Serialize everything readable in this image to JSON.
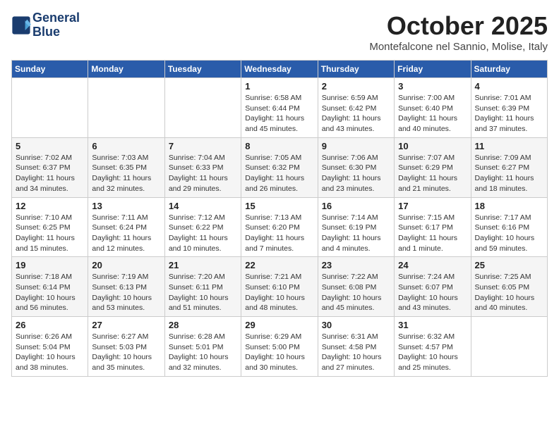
{
  "header": {
    "logo_line1": "General",
    "logo_line2": "Blue",
    "month": "October 2025",
    "location": "Montefalcone nel Sannio, Molise, Italy"
  },
  "weekdays": [
    "Sunday",
    "Monday",
    "Tuesday",
    "Wednesday",
    "Thursday",
    "Friday",
    "Saturday"
  ],
  "weeks": [
    [
      {
        "day": "",
        "info": ""
      },
      {
        "day": "",
        "info": ""
      },
      {
        "day": "",
        "info": ""
      },
      {
        "day": "1",
        "info": "Sunrise: 6:58 AM\nSunset: 6:44 PM\nDaylight: 11 hours and 45 minutes."
      },
      {
        "day": "2",
        "info": "Sunrise: 6:59 AM\nSunset: 6:42 PM\nDaylight: 11 hours and 43 minutes."
      },
      {
        "day": "3",
        "info": "Sunrise: 7:00 AM\nSunset: 6:40 PM\nDaylight: 11 hours and 40 minutes."
      },
      {
        "day": "4",
        "info": "Sunrise: 7:01 AM\nSunset: 6:39 PM\nDaylight: 11 hours and 37 minutes."
      }
    ],
    [
      {
        "day": "5",
        "info": "Sunrise: 7:02 AM\nSunset: 6:37 PM\nDaylight: 11 hours and 34 minutes."
      },
      {
        "day": "6",
        "info": "Sunrise: 7:03 AM\nSunset: 6:35 PM\nDaylight: 11 hours and 32 minutes."
      },
      {
        "day": "7",
        "info": "Sunrise: 7:04 AM\nSunset: 6:33 PM\nDaylight: 11 hours and 29 minutes."
      },
      {
        "day": "8",
        "info": "Sunrise: 7:05 AM\nSunset: 6:32 PM\nDaylight: 11 hours and 26 minutes."
      },
      {
        "day": "9",
        "info": "Sunrise: 7:06 AM\nSunset: 6:30 PM\nDaylight: 11 hours and 23 minutes."
      },
      {
        "day": "10",
        "info": "Sunrise: 7:07 AM\nSunset: 6:29 PM\nDaylight: 11 hours and 21 minutes."
      },
      {
        "day": "11",
        "info": "Sunrise: 7:09 AM\nSunset: 6:27 PM\nDaylight: 11 hours and 18 minutes."
      }
    ],
    [
      {
        "day": "12",
        "info": "Sunrise: 7:10 AM\nSunset: 6:25 PM\nDaylight: 11 hours and 15 minutes."
      },
      {
        "day": "13",
        "info": "Sunrise: 7:11 AM\nSunset: 6:24 PM\nDaylight: 11 hours and 12 minutes."
      },
      {
        "day": "14",
        "info": "Sunrise: 7:12 AM\nSunset: 6:22 PM\nDaylight: 11 hours and 10 minutes."
      },
      {
        "day": "15",
        "info": "Sunrise: 7:13 AM\nSunset: 6:20 PM\nDaylight: 11 hours and 7 minutes."
      },
      {
        "day": "16",
        "info": "Sunrise: 7:14 AM\nSunset: 6:19 PM\nDaylight: 11 hours and 4 minutes."
      },
      {
        "day": "17",
        "info": "Sunrise: 7:15 AM\nSunset: 6:17 PM\nDaylight: 11 hours and 1 minute."
      },
      {
        "day": "18",
        "info": "Sunrise: 7:17 AM\nSunset: 6:16 PM\nDaylight: 10 hours and 59 minutes."
      }
    ],
    [
      {
        "day": "19",
        "info": "Sunrise: 7:18 AM\nSunset: 6:14 PM\nDaylight: 10 hours and 56 minutes."
      },
      {
        "day": "20",
        "info": "Sunrise: 7:19 AM\nSunset: 6:13 PM\nDaylight: 10 hours and 53 minutes."
      },
      {
        "day": "21",
        "info": "Sunrise: 7:20 AM\nSunset: 6:11 PM\nDaylight: 10 hours and 51 minutes."
      },
      {
        "day": "22",
        "info": "Sunrise: 7:21 AM\nSunset: 6:10 PM\nDaylight: 10 hours and 48 minutes."
      },
      {
        "day": "23",
        "info": "Sunrise: 7:22 AM\nSunset: 6:08 PM\nDaylight: 10 hours and 45 minutes."
      },
      {
        "day": "24",
        "info": "Sunrise: 7:24 AM\nSunset: 6:07 PM\nDaylight: 10 hours and 43 minutes."
      },
      {
        "day": "25",
        "info": "Sunrise: 7:25 AM\nSunset: 6:05 PM\nDaylight: 10 hours and 40 minutes."
      }
    ],
    [
      {
        "day": "26",
        "info": "Sunrise: 6:26 AM\nSunset: 5:04 PM\nDaylight: 10 hours and 38 minutes."
      },
      {
        "day": "27",
        "info": "Sunrise: 6:27 AM\nSunset: 5:03 PM\nDaylight: 10 hours and 35 minutes."
      },
      {
        "day": "28",
        "info": "Sunrise: 6:28 AM\nSunset: 5:01 PM\nDaylight: 10 hours and 32 minutes."
      },
      {
        "day": "29",
        "info": "Sunrise: 6:29 AM\nSunset: 5:00 PM\nDaylight: 10 hours and 30 minutes."
      },
      {
        "day": "30",
        "info": "Sunrise: 6:31 AM\nSunset: 4:58 PM\nDaylight: 10 hours and 27 minutes."
      },
      {
        "day": "31",
        "info": "Sunrise: 6:32 AM\nSunset: 4:57 PM\nDaylight: 10 hours and 25 minutes."
      },
      {
        "day": "",
        "info": ""
      }
    ]
  ]
}
